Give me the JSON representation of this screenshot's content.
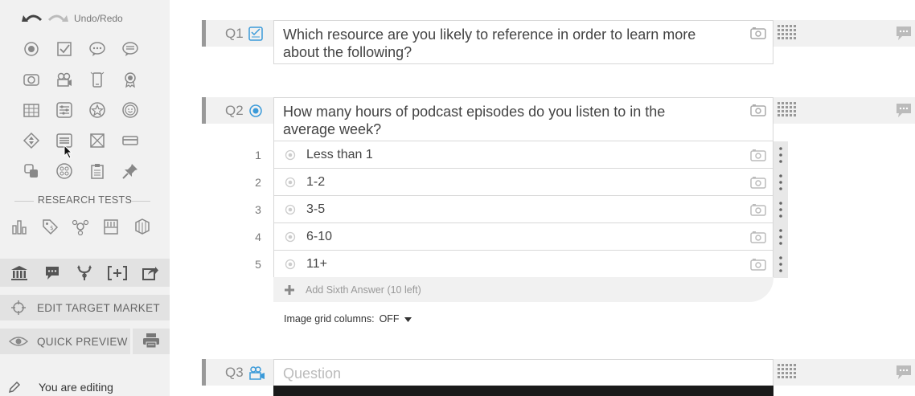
{
  "sidebar": {
    "undo_redo_label": "Undo/Redo",
    "section_label": "RESEARCH TESTS",
    "edit_target_market": "EDIT TARGET MARKET",
    "quick_preview": "QUICK PREVIEW",
    "editing_text": "You are editing"
  },
  "questions": {
    "q1": {
      "number": "Q1",
      "text": "Which resource are you likely to reference in order to learn more about the following?"
    },
    "q2": {
      "number": "Q2",
      "text": "How many hours of podcast episodes do you listen to in the average week?",
      "answers": [
        {
          "num": "1",
          "label": "Less than 1"
        },
        {
          "num": "2",
          "label": "1-2"
        },
        {
          "num": "3",
          "label": "3-5"
        },
        {
          "num": "4",
          "label": "6-10"
        },
        {
          "num": "5",
          "label": "11+"
        }
      ],
      "add_answer": "Add Sixth Answer (10 left)",
      "image_grid_label": "Image grid columns:",
      "image_grid_value": "OFF"
    },
    "q3": {
      "number": "Q3",
      "placeholder": "Question"
    }
  },
  "colors": {
    "sidebar_bg": "#f1f1f1",
    "accent_blue": "#3a9ad9",
    "icon_grey": "#888888"
  }
}
